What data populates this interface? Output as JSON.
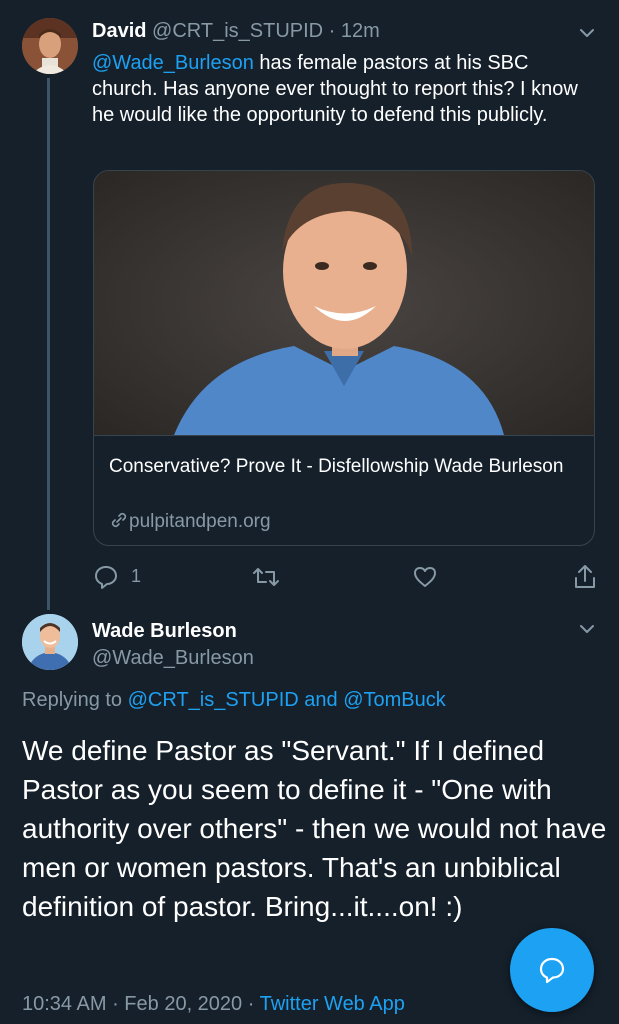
{
  "tweet1": {
    "name": "David",
    "handle": "@CRT_is_STUPID",
    "separator": "·",
    "time": "12m",
    "mention": "@Wade_Burleson",
    "text": " has female pastors at his SBC church. Has anyone ever thought to report this? I know he would like the opportunity to defend this publicly.",
    "card": {
      "title": "Conservative? Prove It - Disfellowship Wade Burleson",
      "domain": "pulpitandpen.org"
    },
    "reply_count": "1"
  },
  "tweet2": {
    "name": "Wade Burleson",
    "handle": "@Wade_Burleson",
    "replying_prefix": "Replying to ",
    "replying_user1": "@CRT_is_STUPID",
    "replying_and": " and ",
    "replying_user2": "@TomBuck",
    "text": "We define Pastor as \"Servant.\" If I defined Pastor as you seem to define it - \"One with authority over others\" - then we would not have men or women pastors. That's an unbiblical definition of pastor. Bring...it....on! :)",
    "time": "10:34 AM",
    "dot1": " · ",
    "date": "Feb 20, 2020",
    "dot2": " · ",
    "source": "Twitter Web App"
  },
  "colors": {
    "background": "#15202b",
    "accent": "#1da1f2",
    "muted": "#8899a6",
    "border": "#38444d"
  },
  "icons": [
    "chevron-down-icon",
    "reply-icon",
    "retweet-icon",
    "like-icon",
    "share-icon",
    "link-icon",
    "compose-reply-icon"
  ]
}
